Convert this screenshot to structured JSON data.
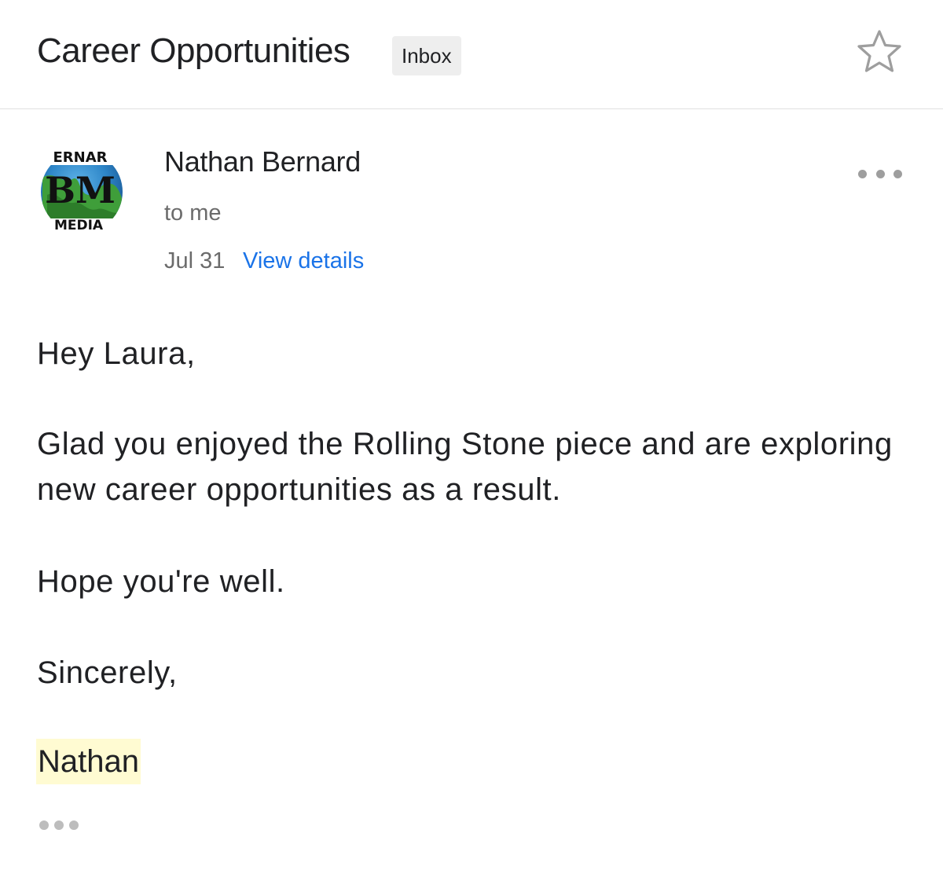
{
  "header": {
    "subject": "Career Opportunities",
    "label": "Inbox",
    "star_icon": "star-outline-icon"
  },
  "message": {
    "avatar": {
      "top_text": "ERNAR",
      "monogram": "BM",
      "bottom_text": "MEDIA"
    },
    "sender": "Nathan Bernard",
    "recipient": "to me",
    "date": "Jul 31",
    "view_details": "View details",
    "more_icon": "more-horizontal-icon"
  },
  "body": {
    "greeting": "Hey Laura,",
    "paragraph": "Glad you enjoyed the Rolling Stone piece and are exploring new career opportunities as a result.",
    "line": "Hope you're well.",
    "closing": "Sincerely,",
    "signature": "Nathan",
    "trimmed_icon": "show-trimmed-content-icon"
  },
  "colors": {
    "link": "#1a73e8",
    "secondary_text": "#6b6b6b",
    "highlight": "#fffbd2",
    "chip_bg": "#eeeeee"
  }
}
